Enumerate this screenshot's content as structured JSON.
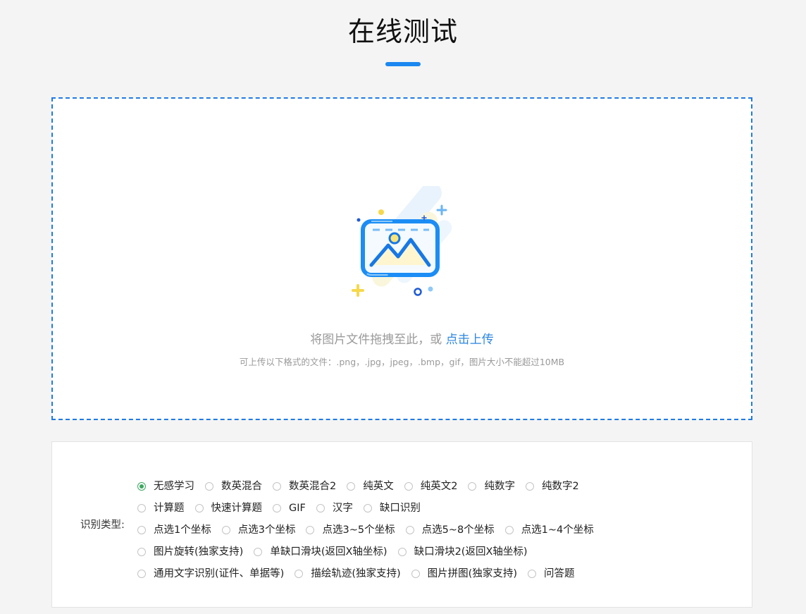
{
  "header": {
    "title": "在线测试"
  },
  "upload": {
    "hint_prefix": "将图片文件拖拽至此，或 ",
    "hint_link": "点击上传",
    "formats": "可上传以下格式的文件：.png，.jpg，jpeg，.bmp，gif，图片大小不能超过10MB",
    "illustration_icon": "image-upload-icon"
  },
  "recognition": {
    "label": "识别类型:",
    "selected": "无感学习",
    "accent_color": "#3da760",
    "rows": [
      [
        "无感学习",
        "数英混合",
        "数英混合2",
        "纯英文",
        "纯英文2",
        "纯数字",
        "纯数字2"
      ],
      [
        "计算题",
        "快速计算题",
        "GIF",
        "汉字",
        "缺口识别"
      ],
      [
        "点选1个坐标",
        "点选3个坐标",
        "点选3~5个坐标",
        "点选5~8个坐标",
        "点选1~4个坐标"
      ],
      [
        "图片旋转(独家支持)",
        "单缺口滑块(返回X轴坐标)",
        "缺口滑块2(返回X轴坐标)"
      ],
      [
        "通用文字识别(证件、单据等)",
        "描绘轨迹(独家支持)",
        "图片拼图(独家支持)",
        "问答题"
      ]
    ]
  },
  "colors": {
    "primary": "#1b87f0",
    "dashed_border": "#1f7ae6",
    "link": "#2c86e1",
    "background": "#f4f4f4"
  }
}
